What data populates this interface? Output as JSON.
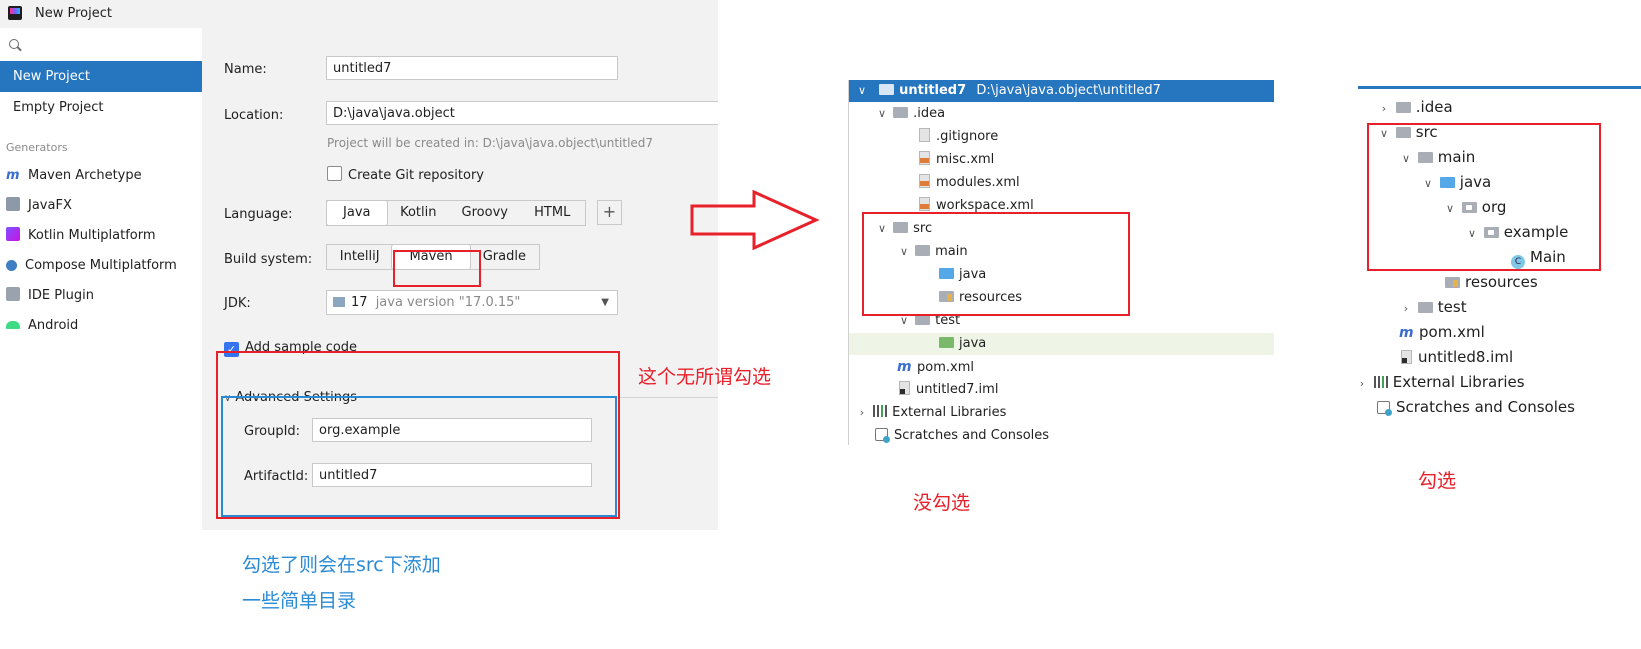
{
  "window": {
    "title": "New Project"
  },
  "sidebar": {
    "items": [
      {
        "label": "New Project",
        "selected": true
      },
      {
        "label": "Empty Project",
        "selected": false
      }
    ],
    "generators_header": "Generators",
    "generators": [
      {
        "label": "Maven Archetype",
        "icon": "maven-icon"
      },
      {
        "label": "JavaFX",
        "icon": "javafx-icon"
      },
      {
        "label": "Kotlin Multiplatform",
        "icon": "kotlin-icon"
      },
      {
        "label": "Compose Multiplatform",
        "icon": "compose-icon"
      },
      {
        "label": "IDE Plugin",
        "icon": "plugin-icon"
      },
      {
        "label": "Android",
        "icon": "android-icon"
      }
    ]
  },
  "form": {
    "name_label": "Name:",
    "name_value": "untitled7",
    "location_label": "Location:",
    "location_value": "D:\\java\\java.object",
    "location_hint": "Project will be created in: D:\\java\\java.object\\untitled7",
    "git_label": "Create Git repository",
    "language_label": "Language:",
    "languages": [
      "Java",
      "Kotlin",
      "Groovy",
      "HTML"
    ],
    "language_add": "+",
    "build_label": "Build system:",
    "build_systems": [
      "IntelliJ",
      "Maven",
      "Gradle"
    ],
    "jdk_label": "JDK:",
    "jdk_version": "17",
    "jdk_detail": "java version \"17.0.15\"",
    "sample_label": "Add sample code",
    "advanced_label": "Advanced Settings",
    "groupid_label": "GroupId:",
    "groupid_value": "org.example",
    "artifactid_label": "ArtifactId:",
    "artifactid_value": "untitled7"
  },
  "annotations": {
    "checkbox_note": "这个无所谓勾选",
    "checked_note_line1": "勾选了则会在src下添加",
    "checked_note_line2": "一些简单目录",
    "unchecked_caption": "没勾选",
    "checked_caption": "勾选"
  },
  "tree_left": {
    "root_name": "untitled7",
    "root_path": "D:\\java\\java.object\\untitled7",
    "idea": ".idea",
    "gitignore": ".gitignore",
    "misc": "misc.xml",
    "modules": "modules.xml",
    "workspace": "workspace.xml",
    "src": "src",
    "main": "main",
    "java": "java",
    "resources": "resources",
    "test": "test",
    "test_java": "java",
    "pom": "pom.xml",
    "iml": "untitled7.iml",
    "libraries": "External Libraries",
    "scratches": "Scratches and Consoles"
  },
  "tree_right": {
    "idea": ".idea",
    "src": "src",
    "main": "main",
    "java": "java",
    "org": "org",
    "example": "example",
    "main_class": "Main",
    "resources": "resources",
    "test": "test",
    "pom": "pom.xml",
    "iml": "untitled8.iml",
    "libraries": "External Libraries",
    "scratches": "Scratches and Consoles"
  },
  "colors": {
    "accent": "#2675bf",
    "annotation_red": "#e8202a",
    "annotation_blue": "#2a8ad4"
  }
}
